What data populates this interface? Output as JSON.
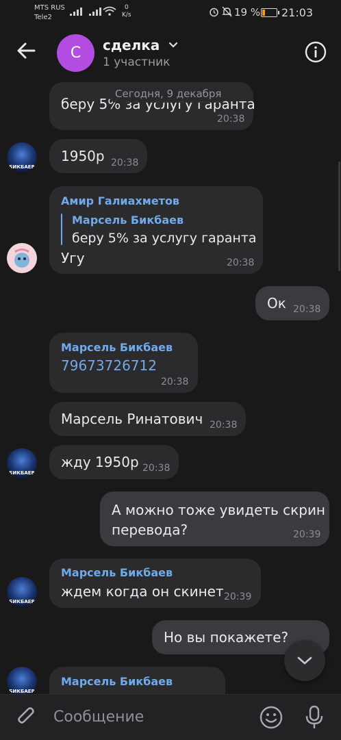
{
  "status_bar": {
    "carrier1": "MTS RUS",
    "carrier2": "Tele2",
    "speed_value": "0",
    "speed_unit": "K/s",
    "battery_percent": "19 %",
    "time": "21:03",
    "battery_level": 0.19
  },
  "header": {
    "avatar_letter": "С",
    "title": "сделка",
    "subtitle": "1 участник"
  },
  "date_separator": "Сегодня, 9 декабря",
  "messages": [
    {
      "text": "беру 5% за услугу гаранта",
      "time": "20:38"
    },
    {
      "text": "1950р",
      "time": "20:38"
    },
    {
      "sender": "Амир Галиахметов",
      "reply_sender": "Марсель Бикбаев",
      "reply_text": "беру 5% за услугу гаранта",
      "text": "Угу",
      "time": "20:38"
    },
    {
      "text": "Ок",
      "time": "20:38"
    },
    {
      "sender": "Марсель Бикбаев",
      "text": "79673726712",
      "time": "20:38"
    },
    {
      "text": "Марсель Ринатович",
      "time": "20:38"
    },
    {
      "text": "жду 1950р",
      "time": "20:38"
    },
    {
      "text_line1": "А можно тоже увидеть скрин",
      "text_line2": "перевода?",
      "time": "20:39"
    },
    {
      "sender": "Марсель Бикбаев",
      "text": "ждем когда он скинет",
      "time": "20:39"
    },
    {
      "text": "Но вы покажете?"
    },
    {
      "sender": "Марсель Бикбаев"
    }
  ],
  "avatar_caption": "БИКБАЕВ",
  "composer": {
    "placeholder": "Сообщение"
  },
  "colors": {
    "background": "#19191a",
    "bubble_in": "#2b2b2e",
    "bubble_out": "#3a3b3e",
    "accent_link": "#71aaeb",
    "avatar_chat": "#b34ce0"
  }
}
